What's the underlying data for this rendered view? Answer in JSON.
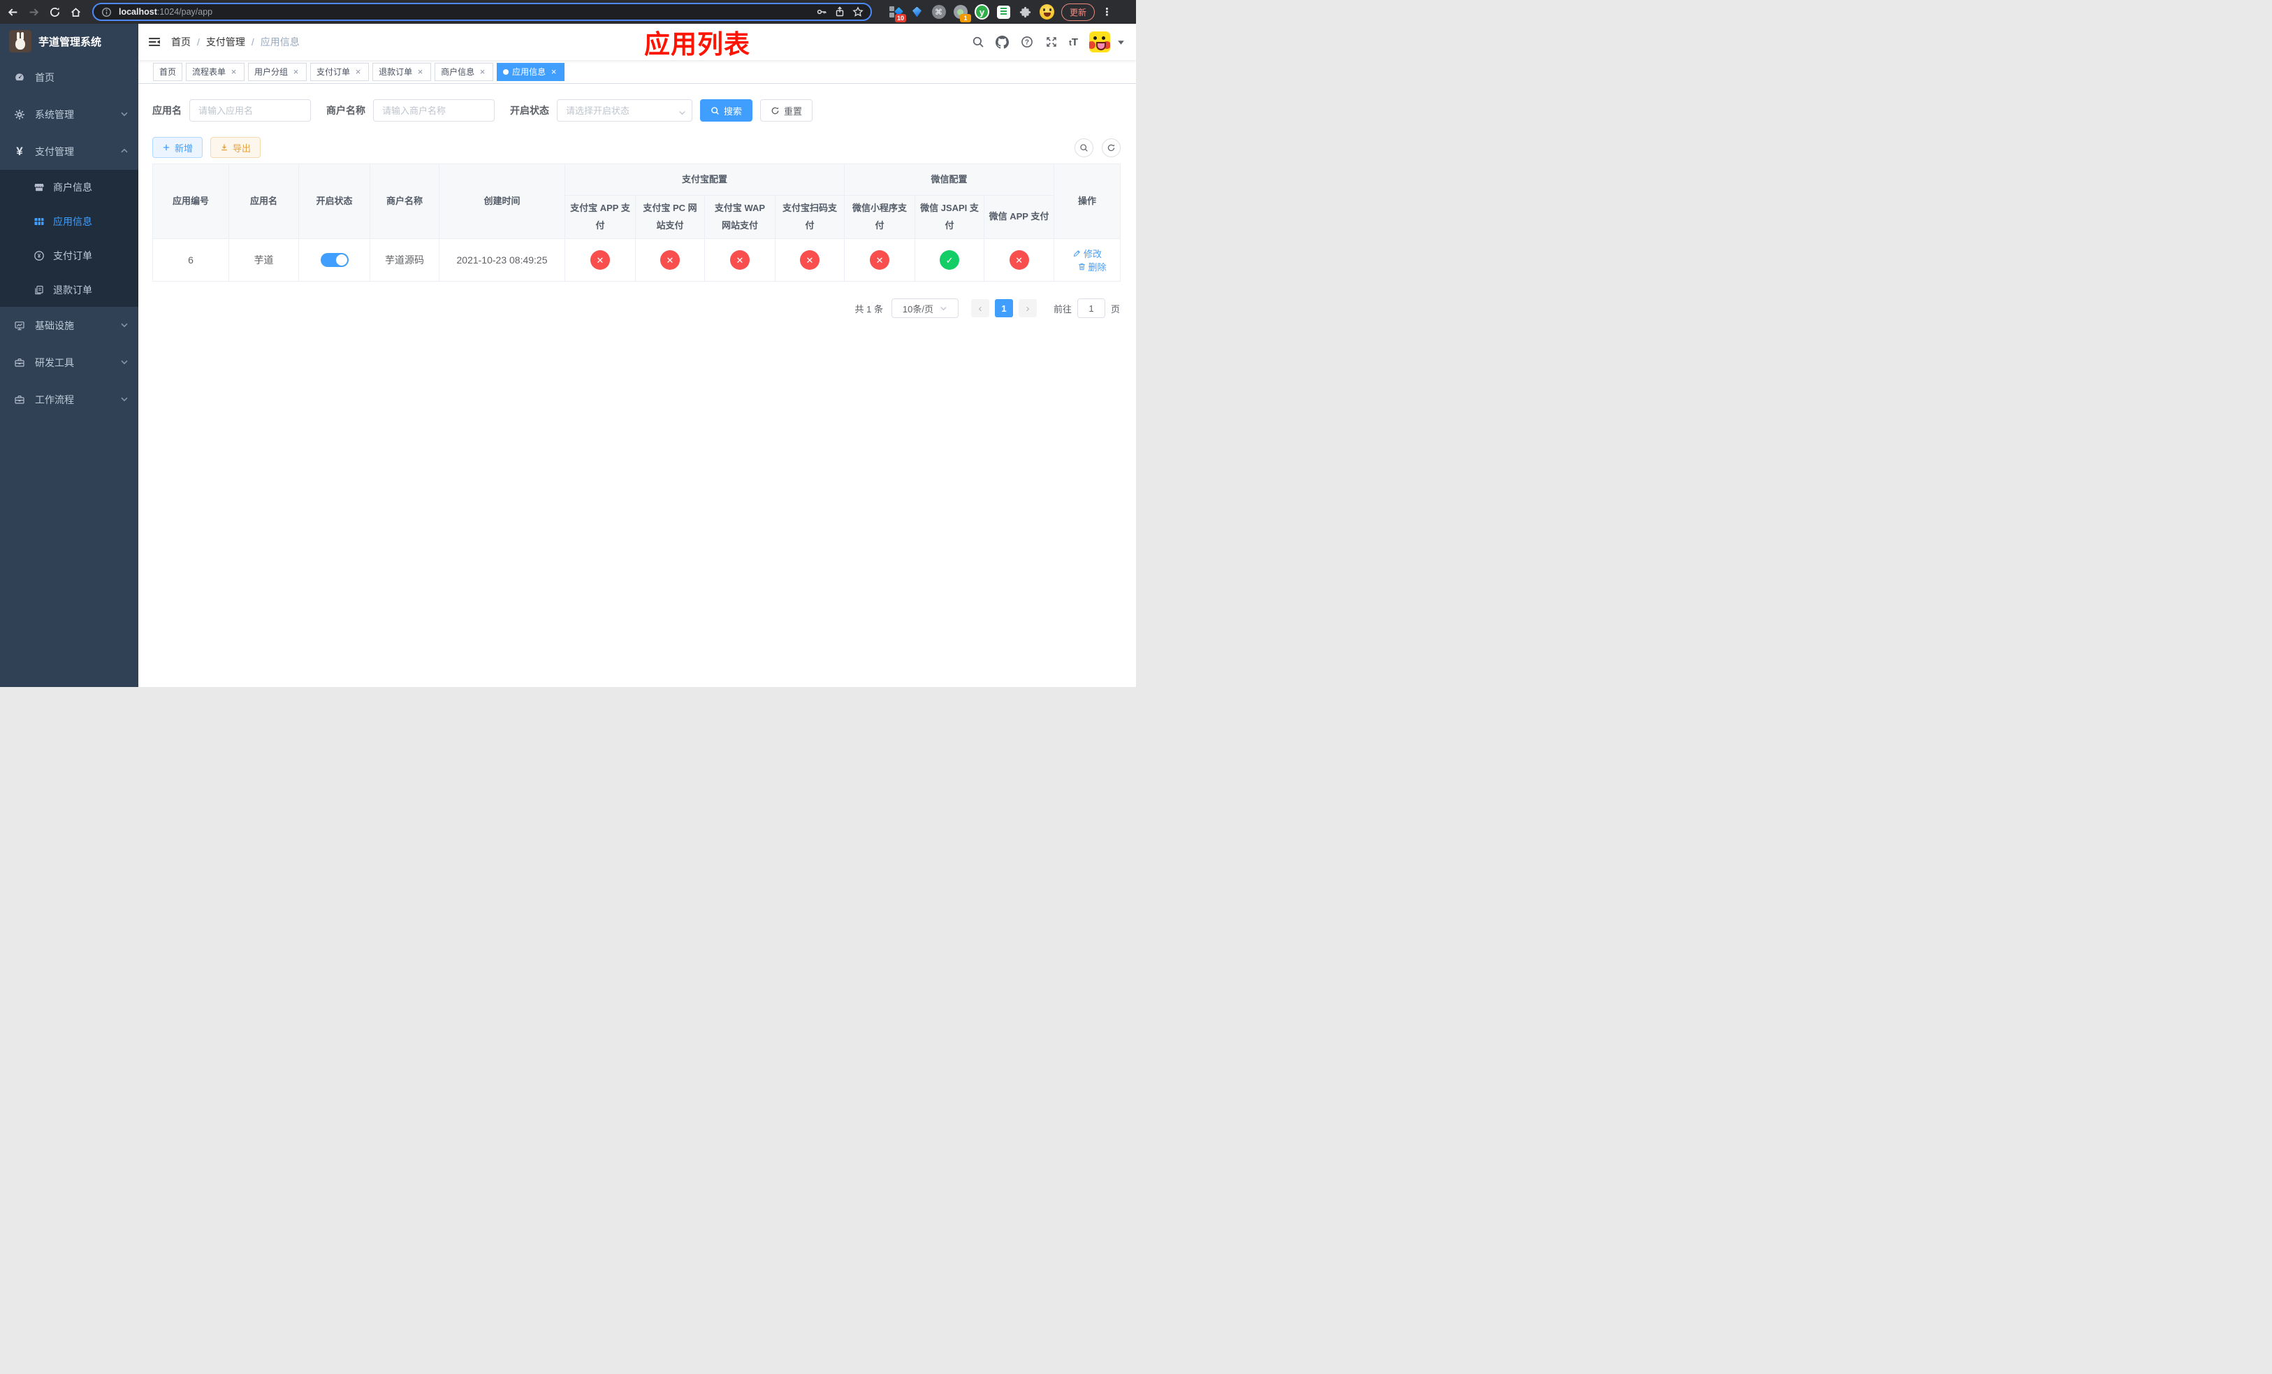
{
  "browser": {
    "url_host": "localhost",
    "url_path": ":1024/pay/app",
    "update_label": "更新",
    "ext_badge_10": "10",
    "ext_badge_1": "1",
    "ext_y_label": "y"
  },
  "sidebar": {
    "title": "芋道管理系统",
    "items": [
      {
        "label": "首页",
        "icon": "dashboard-icon"
      },
      {
        "label": "系统管理",
        "icon": "gear-icon",
        "expandable": true,
        "expanded": false
      },
      {
        "label": "支付管理",
        "icon": "yen-icon",
        "expandable": true,
        "expanded": true,
        "children": [
          {
            "label": "商户信息",
            "icon": "shop-icon",
            "active": false
          },
          {
            "label": "应用信息",
            "icon": "grid-icon",
            "active": true
          },
          {
            "label": "支付订单",
            "icon": "pay-order-icon",
            "active": false
          },
          {
            "label": "退款订单",
            "icon": "refund-icon",
            "active": false
          }
        ]
      },
      {
        "label": "基础设施",
        "icon": "monitor-icon",
        "expandable": true,
        "expanded": false
      },
      {
        "label": "研发工具",
        "icon": "toolbox-icon",
        "expandable": true,
        "expanded": false
      },
      {
        "label": "工作流程",
        "icon": "toolbox-icon",
        "expandable": true,
        "expanded": false
      }
    ]
  },
  "header": {
    "breadcrumb": [
      "首页",
      "支付管理",
      "应用信息"
    ],
    "annotation": "应用列表"
  },
  "tabs": {
    "items": [
      {
        "label": "首页",
        "closable": false,
        "active": false
      },
      {
        "label": "流程表单",
        "closable": true,
        "active": false
      },
      {
        "label": "用户分组",
        "closable": true,
        "active": false
      },
      {
        "label": "支付订单",
        "closable": true,
        "active": false
      },
      {
        "label": "退款订单",
        "closable": true,
        "active": false
      },
      {
        "label": "商户信息",
        "closable": true,
        "active": false
      },
      {
        "label": "应用信息",
        "closable": true,
        "active": true
      }
    ]
  },
  "search": {
    "fields": [
      {
        "label": "应用名",
        "placeholder": "请输入应用名",
        "type": "text"
      },
      {
        "label": "商户名称",
        "placeholder": "请输入商户名称",
        "type": "text"
      },
      {
        "label": "开启状态",
        "placeholder": "请选择开启状态",
        "type": "select"
      }
    ],
    "search_label": "搜索",
    "reset_label": "重置"
  },
  "toolbar": {
    "add_label": "新增",
    "export_label": "导出"
  },
  "table": {
    "columns": [
      "应用编号",
      "应用名",
      "开启状态",
      "商户名称",
      "创建时间"
    ],
    "groups": [
      {
        "label": "支付宝配置",
        "children": [
          "支付宝 APP 支付",
          "支付宝 PC 网站支付",
          "支付宝 WAP 网站支付",
          "支付宝扫码支付"
        ]
      },
      {
        "label": "微信配置",
        "children": [
          "微信小程序支付",
          "微信 JSAPI 支付",
          "微信 APP 支付"
        ]
      }
    ],
    "op_label": "操作",
    "rows": [
      {
        "id": "6",
        "name": "芋道",
        "enabled": true,
        "merchant": "芋道源码",
        "created_at": "2021-10-23 08:49:25",
        "channels": [
          false,
          false,
          false,
          false,
          false,
          true,
          false
        ],
        "actions": {
          "edit": "修改",
          "delete": "删除"
        }
      }
    ]
  },
  "pagination": {
    "total_label": "共 1 条",
    "page_size": "10条/页",
    "current": "1",
    "goto_label": "前往",
    "goto_value": "1",
    "page_label": "页"
  },
  "icons": {
    "cross": "✕",
    "check": "✓",
    "close": "×",
    "cmd": "⌘",
    "prev": "‹",
    "next": "›",
    "dots": "⋮",
    "yen": "¥",
    "yen_small": "¥"
  },
  "colors": {
    "accent": "#409eff",
    "success": "#13ce66",
    "danger": "#f84e4e",
    "warning": "#e6a23c",
    "sidebar_bg": "#304156",
    "submenu_bg": "#1f2d3d",
    "active_tab_bg": "#409eff",
    "annotation_red": "#fe1400"
  }
}
